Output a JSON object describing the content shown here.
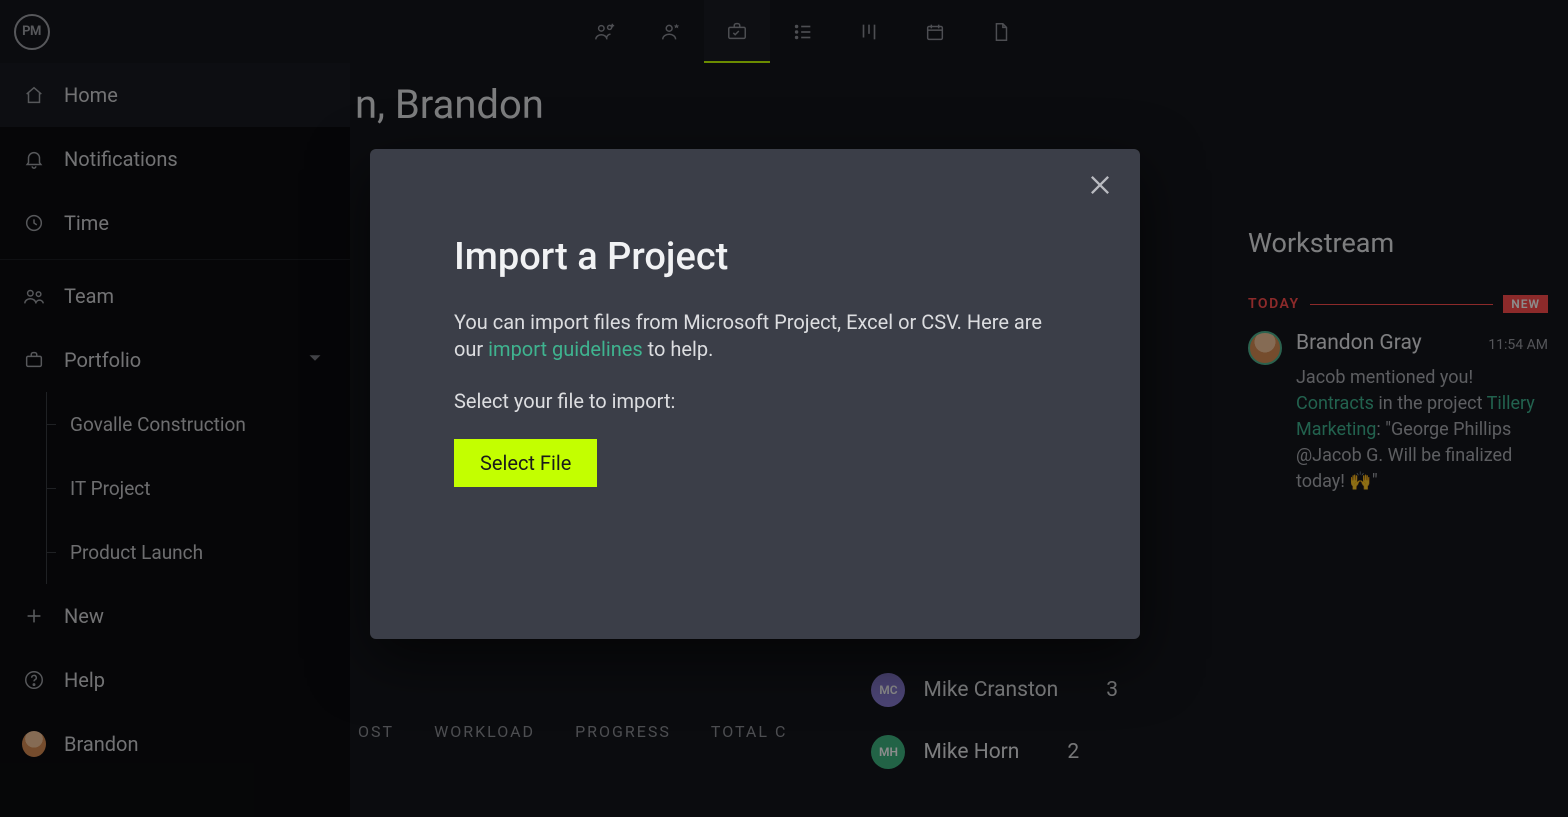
{
  "logo": "PM",
  "sidebar": {
    "items": [
      {
        "label": "Home"
      },
      {
        "label": "Notifications"
      },
      {
        "label": "Time"
      },
      {
        "label": "Team"
      },
      {
        "label": "Portfolio"
      }
    ],
    "portfolio_items": [
      {
        "label": "Govalle Construction"
      },
      {
        "label": "IT Project"
      },
      {
        "label": "Product Launch"
      }
    ],
    "new_label": "New",
    "help_label": "Help",
    "user_label": "Brandon"
  },
  "main": {
    "greeting": "n, Brandon",
    "tabs": [
      "OST",
      "WORKLOAD",
      "PROGRESS",
      "TOTAL C"
    ],
    "team_rows": [
      {
        "initials": "MC",
        "name": "Mike Cranston",
        "count": "3"
      },
      {
        "initials": "MH",
        "name": "Mike Horn",
        "count": "2"
      }
    ]
  },
  "workstream": {
    "title": "Workstream",
    "today_label": "TODAY",
    "new_badge": "NEW",
    "item": {
      "name": "Brandon Gray",
      "time": "11:54 AM",
      "line1": "Jacob mentioned you!",
      "link1": "Contracts",
      "mid1": " in the project ",
      "link2": "Tillery Marketing",
      "tail": ": \"George Phillips @Jacob G. Will be finalized today! 🙌\""
    }
  },
  "modal": {
    "title": "Import a Project",
    "body_a": "You can import files from Microsoft Project, Excel or CSV. Here are our ",
    "body_link": "import guidelines",
    "body_b": " to help.",
    "select_prompt": "Select your file to import:",
    "button": "Select File"
  }
}
